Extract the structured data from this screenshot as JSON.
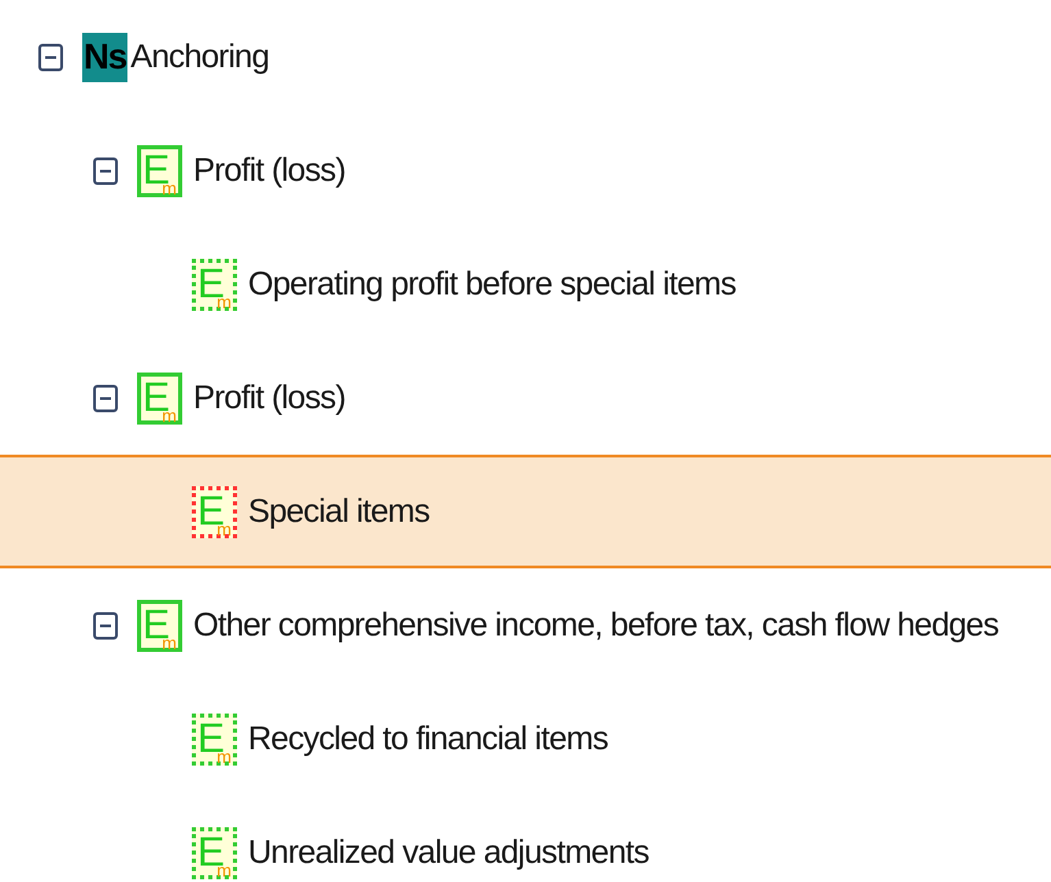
{
  "tree": [
    {
      "label": "Anchoring",
      "kind": "namespace",
      "icon_text": "Ns",
      "expanded": true,
      "selected": false,
      "children": [
        {
          "label": "Profit (loss)",
          "kind": "element",
          "icon_text": "E",
          "icon_sub": "m",
          "dotted": false,
          "color": "#33cc33",
          "expanded": true,
          "selected": false,
          "children": [
            {
              "label": "Operating profit before special items",
              "kind": "element",
              "icon_text": "E",
              "icon_sub": "m",
              "dotted": true,
              "color": "#33cc33",
              "selected": false
            }
          ]
        },
        {
          "label": "Profit (loss)",
          "kind": "element",
          "icon_text": "E",
          "icon_sub": "m",
          "dotted": false,
          "color": "#33cc33",
          "expanded": true,
          "selected": false,
          "children": [
            {
              "label": "Special items",
              "kind": "element",
              "icon_text": "E",
              "icon_sub": "m",
              "dotted": true,
              "color": "#ff3333",
              "selected": true
            }
          ]
        },
        {
          "label": "Other comprehensive income, before tax, cash flow hedges",
          "kind": "element",
          "icon_text": "E",
          "icon_sub": "m",
          "dotted": false,
          "color": "#33cc33",
          "expanded": true,
          "selected": false,
          "children": [
            {
              "label": "Recycled to financial items",
              "kind": "element",
              "icon_text": "E",
              "icon_sub": "m",
              "dotted": true,
              "color": "#33cc33",
              "selected": false
            },
            {
              "label": "Unrealized value adjustments",
              "kind": "element",
              "icon_text": "E",
              "icon_sub": "m",
              "dotted": true,
              "color": "#33cc33",
              "selected": false
            }
          ]
        }
      ]
    }
  ]
}
